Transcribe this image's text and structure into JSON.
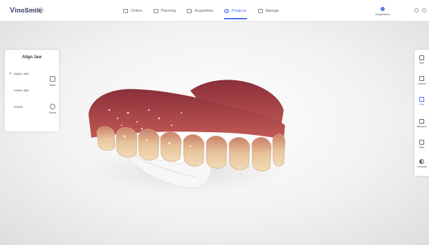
{
  "app": {
    "logo_text_v": "V",
    "logo_text_rest": "inoSmile"
  },
  "tabs": [
    {
      "label": "Orders",
      "icon": "orders-icon",
      "active": false
    },
    {
      "label": "Planning",
      "icon": "planning-icon",
      "active": false
    },
    {
      "label": "Acquisition",
      "icon": "acquisition-icon",
      "active": false
    },
    {
      "label": "Postproc",
      "icon": "postprocess-icon",
      "active": true
    },
    {
      "label": "Manage",
      "icon": "manage-icon",
      "active": false
    }
  ],
  "registration": {
    "label": "Registration"
  },
  "left_panel": {
    "title": "Align Jaw",
    "items": [
      {
        "label": "Upper Jaw",
        "selected": true
      },
      {
        "label": "Lower Jaw",
        "selected": false
      },
      {
        "label": "Check",
        "selected": false
      }
    ],
    "tools": [
      {
        "label": "Align",
        "icon": "align-icon"
      },
      {
        "label": "Reset",
        "icon": "reset-icon"
      }
    ]
  },
  "right_toolbar": [
    {
      "label": "Split",
      "icon": "split-icon",
      "active": false
    },
    {
      "label": "Capture",
      "icon": "capture-icon",
      "active": false
    },
    {
      "label": "Bite",
      "icon": "bite-icon",
      "active": true
    },
    {
      "label": "Measure",
      "icon": "measure-icon",
      "active": false
    },
    {
      "label": "Base",
      "icon": "base-icon",
      "active": false
    },
    {
      "label": "Compare",
      "icon": "compare-icon",
      "active": false
    }
  ],
  "colors": {
    "accent": "#4a6cf0",
    "gum": "#b0454a",
    "tooth": "#e8c79a",
    "lower_jaw": "#f7f7f7"
  }
}
